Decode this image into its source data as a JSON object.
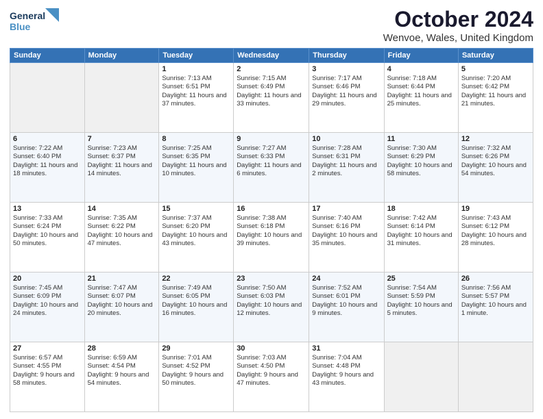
{
  "header": {
    "logo_line1": "General",
    "logo_line2": "Blue",
    "title": "October 2024",
    "subtitle": "Wenvoe, Wales, United Kingdom"
  },
  "days_of_week": [
    "Sunday",
    "Monday",
    "Tuesday",
    "Wednesday",
    "Thursday",
    "Friday",
    "Saturday"
  ],
  "weeks": [
    [
      {
        "day": "",
        "content": ""
      },
      {
        "day": "",
        "content": ""
      },
      {
        "day": "1",
        "content": "Sunrise: 7:13 AM\nSunset: 6:51 PM\nDaylight: 11 hours and 37 minutes."
      },
      {
        "day": "2",
        "content": "Sunrise: 7:15 AM\nSunset: 6:49 PM\nDaylight: 11 hours and 33 minutes."
      },
      {
        "day": "3",
        "content": "Sunrise: 7:17 AM\nSunset: 6:46 PM\nDaylight: 11 hours and 29 minutes."
      },
      {
        "day": "4",
        "content": "Sunrise: 7:18 AM\nSunset: 6:44 PM\nDaylight: 11 hours and 25 minutes."
      },
      {
        "day": "5",
        "content": "Sunrise: 7:20 AM\nSunset: 6:42 PM\nDaylight: 11 hours and 21 minutes."
      }
    ],
    [
      {
        "day": "6",
        "content": "Sunrise: 7:22 AM\nSunset: 6:40 PM\nDaylight: 11 hours and 18 minutes."
      },
      {
        "day": "7",
        "content": "Sunrise: 7:23 AM\nSunset: 6:37 PM\nDaylight: 11 hours and 14 minutes."
      },
      {
        "day": "8",
        "content": "Sunrise: 7:25 AM\nSunset: 6:35 PM\nDaylight: 11 hours and 10 minutes."
      },
      {
        "day": "9",
        "content": "Sunrise: 7:27 AM\nSunset: 6:33 PM\nDaylight: 11 hours and 6 minutes."
      },
      {
        "day": "10",
        "content": "Sunrise: 7:28 AM\nSunset: 6:31 PM\nDaylight: 11 hours and 2 minutes."
      },
      {
        "day": "11",
        "content": "Sunrise: 7:30 AM\nSunset: 6:29 PM\nDaylight: 10 hours and 58 minutes."
      },
      {
        "day": "12",
        "content": "Sunrise: 7:32 AM\nSunset: 6:26 PM\nDaylight: 10 hours and 54 minutes."
      }
    ],
    [
      {
        "day": "13",
        "content": "Sunrise: 7:33 AM\nSunset: 6:24 PM\nDaylight: 10 hours and 50 minutes."
      },
      {
        "day": "14",
        "content": "Sunrise: 7:35 AM\nSunset: 6:22 PM\nDaylight: 10 hours and 47 minutes."
      },
      {
        "day": "15",
        "content": "Sunrise: 7:37 AM\nSunset: 6:20 PM\nDaylight: 10 hours and 43 minutes."
      },
      {
        "day": "16",
        "content": "Sunrise: 7:38 AM\nSunset: 6:18 PM\nDaylight: 10 hours and 39 minutes."
      },
      {
        "day": "17",
        "content": "Sunrise: 7:40 AM\nSunset: 6:16 PM\nDaylight: 10 hours and 35 minutes."
      },
      {
        "day": "18",
        "content": "Sunrise: 7:42 AM\nSunset: 6:14 PM\nDaylight: 10 hours and 31 minutes."
      },
      {
        "day": "19",
        "content": "Sunrise: 7:43 AM\nSunset: 6:12 PM\nDaylight: 10 hours and 28 minutes."
      }
    ],
    [
      {
        "day": "20",
        "content": "Sunrise: 7:45 AM\nSunset: 6:09 PM\nDaylight: 10 hours and 24 minutes."
      },
      {
        "day": "21",
        "content": "Sunrise: 7:47 AM\nSunset: 6:07 PM\nDaylight: 10 hours and 20 minutes."
      },
      {
        "day": "22",
        "content": "Sunrise: 7:49 AM\nSunset: 6:05 PM\nDaylight: 10 hours and 16 minutes."
      },
      {
        "day": "23",
        "content": "Sunrise: 7:50 AM\nSunset: 6:03 PM\nDaylight: 10 hours and 12 minutes."
      },
      {
        "day": "24",
        "content": "Sunrise: 7:52 AM\nSunset: 6:01 PM\nDaylight: 10 hours and 9 minutes."
      },
      {
        "day": "25",
        "content": "Sunrise: 7:54 AM\nSunset: 5:59 PM\nDaylight: 10 hours and 5 minutes."
      },
      {
        "day": "26",
        "content": "Sunrise: 7:56 AM\nSunset: 5:57 PM\nDaylight: 10 hours and 1 minute."
      }
    ],
    [
      {
        "day": "27",
        "content": "Sunrise: 6:57 AM\nSunset: 4:55 PM\nDaylight: 9 hours and 58 minutes."
      },
      {
        "day": "28",
        "content": "Sunrise: 6:59 AM\nSunset: 4:54 PM\nDaylight: 9 hours and 54 minutes."
      },
      {
        "day": "29",
        "content": "Sunrise: 7:01 AM\nSunset: 4:52 PM\nDaylight: 9 hours and 50 minutes."
      },
      {
        "day": "30",
        "content": "Sunrise: 7:03 AM\nSunset: 4:50 PM\nDaylight: 9 hours and 47 minutes."
      },
      {
        "day": "31",
        "content": "Sunrise: 7:04 AM\nSunset: 4:48 PM\nDaylight: 9 hours and 43 minutes."
      },
      {
        "day": "",
        "content": ""
      },
      {
        "day": "",
        "content": ""
      }
    ]
  ]
}
